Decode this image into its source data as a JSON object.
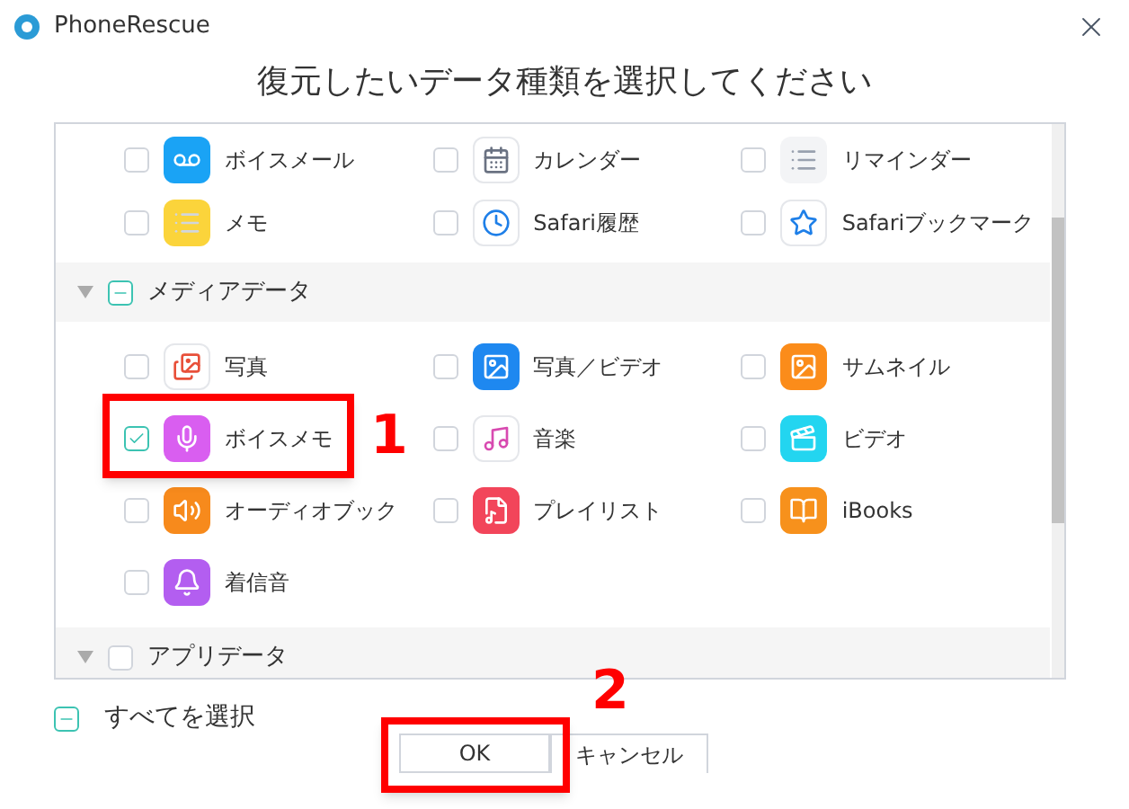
{
  "window": {
    "title": "PhoneRescue"
  },
  "heading": "復元したいデータ種類を選択してください",
  "sections": [
    {
      "items": [
        {
          "label": "ボイスメール",
          "checked": false
        },
        {
          "label": "カレンダー",
          "checked": false
        },
        {
          "label": "リマインダー",
          "checked": false
        },
        {
          "label": "メモ",
          "checked": false
        },
        {
          "label": "Safari履歴",
          "checked": false
        },
        {
          "label": "Safariブックマーク",
          "checked": false
        }
      ]
    },
    {
      "title": "メディアデータ",
      "partial": true,
      "items": [
        {
          "label": "写真",
          "checked": false
        },
        {
          "label": "写真／ビデオ",
          "checked": false
        },
        {
          "label": "サムネイル",
          "checked": false
        },
        {
          "label": "ボイスメモ",
          "checked": true
        },
        {
          "label": "音楽",
          "checked": false
        },
        {
          "label": "ビデオ",
          "checked": false
        },
        {
          "label": "オーディオブック",
          "checked": false
        },
        {
          "label": "プレイリスト",
          "checked": false
        },
        {
          "label": "iBooks",
          "checked": false
        },
        {
          "label": "着信音",
          "checked": false
        }
      ]
    },
    {
      "title": "アプリデータ",
      "partial": false
    }
  ],
  "select_all": {
    "label": "すべてを選択",
    "partial": true
  },
  "buttons": [
    {
      "label": "OK",
      "kind": "primary"
    },
    {
      "label": "キャンセル",
      "kind": "secondary"
    }
  ],
  "annotations": [
    {
      "text": "1"
    },
    {
      "text": "2"
    }
  ]
}
